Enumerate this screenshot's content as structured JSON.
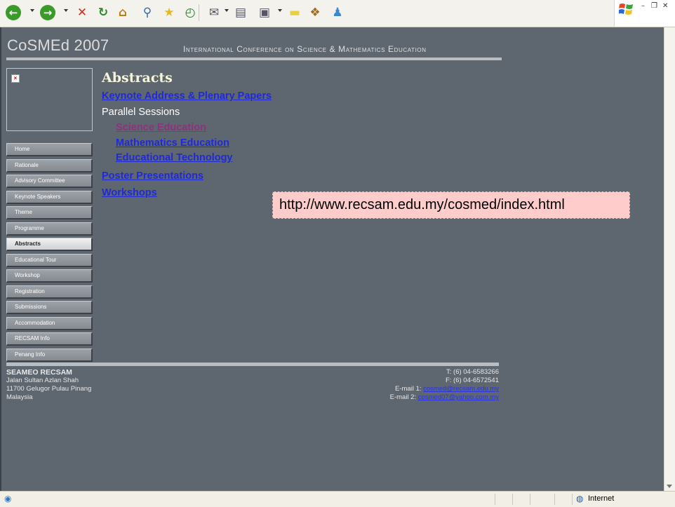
{
  "browser": {
    "toolbar_icons": [
      {
        "name": "back-icon",
        "glyph": "←",
        "color": "#3a9a2a"
      },
      {
        "name": "forward-icon",
        "glyph": "→",
        "color": "#3a9a2a"
      },
      {
        "name": "stop-icon",
        "glyph": "✕",
        "color": "#d02a1a"
      },
      {
        "name": "refresh-icon",
        "glyph": "↻",
        "color": "#2a8a2a"
      },
      {
        "name": "home-icon",
        "glyph": "⌂",
        "color": "#c07a10"
      },
      {
        "name": "search-icon",
        "glyph": "⚲",
        "color": "#3a6ab0"
      },
      {
        "name": "favorites-icon",
        "glyph": "★",
        "color": "#e8b820"
      },
      {
        "name": "history-icon",
        "glyph": "◴",
        "color": "#2a7a2a"
      },
      {
        "name": "mail-icon",
        "glyph": "✉",
        "color": "#556"
      },
      {
        "name": "print-icon",
        "glyph": "▤",
        "color": "#556"
      },
      {
        "name": "edit-icon",
        "glyph": "▣",
        "color": "#556"
      },
      {
        "name": "note-icon",
        "glyph": "▬",
        "color": "#e8d040"
      },
      {
        "name": "research-icon",
        "glyph": "❖",
        "color": "#a06a20"
      },
      {
        "name": "messenger-icon",
        "glyph": "♟",
        "color": "#3a8ad0"
      }
    ],
    "status_zone": "Internet"
  },
  "site": {
    "title": "CoSMEd 2007",
    "subtitle": "International Conference on Science & Mathematics Education"
  },
  "nav": [
    {
      "label": "Home",
      "active": false
    },
    {
      "label": "Rationale",
      "active": false
    },
    {
      "label": "Advisory Committee",
      "active": false
    },
    {
      "label": "Keynote Speakers",
      "active": false
    },
    {
      "label": "Theme",
      "active": false
    },
    {
      "label": "Programme",
      "active": false
    },
    {
      "label": "Abstracts",
      "active": true
    },
    {
      "label": "Educational Tour",
      "active": false
    },
    {
      "label": "Workshop",
      "active": false
    },
    {
      "label": "Registration",
      "active": false
    },
    {
      "label": "Submissions",
      "active": false
    },
    {
      "label": "Accommodation",
      "active": false
    },
    {
      "label": "RECSAM Info",
      "active": false
    },
    {
      "label": "Penang Info",
      "active": false
    }
  ],
  "content": {
    "title": "Abstracts",
    "keynote_link": "Keynote Address & Plenary Papers",
    "parallel_heading": "Parallel Sessions",
    "science_link": "Science Education",
    "math_link": "Mathematics Education",
    "tech_link": "Educational Technology",
    "poster_link": "Poster Presentations",
    "workshops_link": "Workshops"
  },
  "url_annotation": "http://www.recsam.edu.my/cosmed/index.html",
  "footer": {
    "org": "SEAMEO RECSAM",
    "address1": "Jalan Sultan Azlan Shah",
    "address2": "11700 Gelugor Pulau Pinang",
    "address3": "Malaysia",
    "phone": "T: (6) 04-6583266",
    "fax": "F: (6) 04-6572541",
    "email1_label": "E-mail 1:",
    "email1": "cosmed@recsam.edu.my",
    "email2_label": "E-mail 2:",
    "email2": "cosmed07@yahoo.com.my"
  }
}
